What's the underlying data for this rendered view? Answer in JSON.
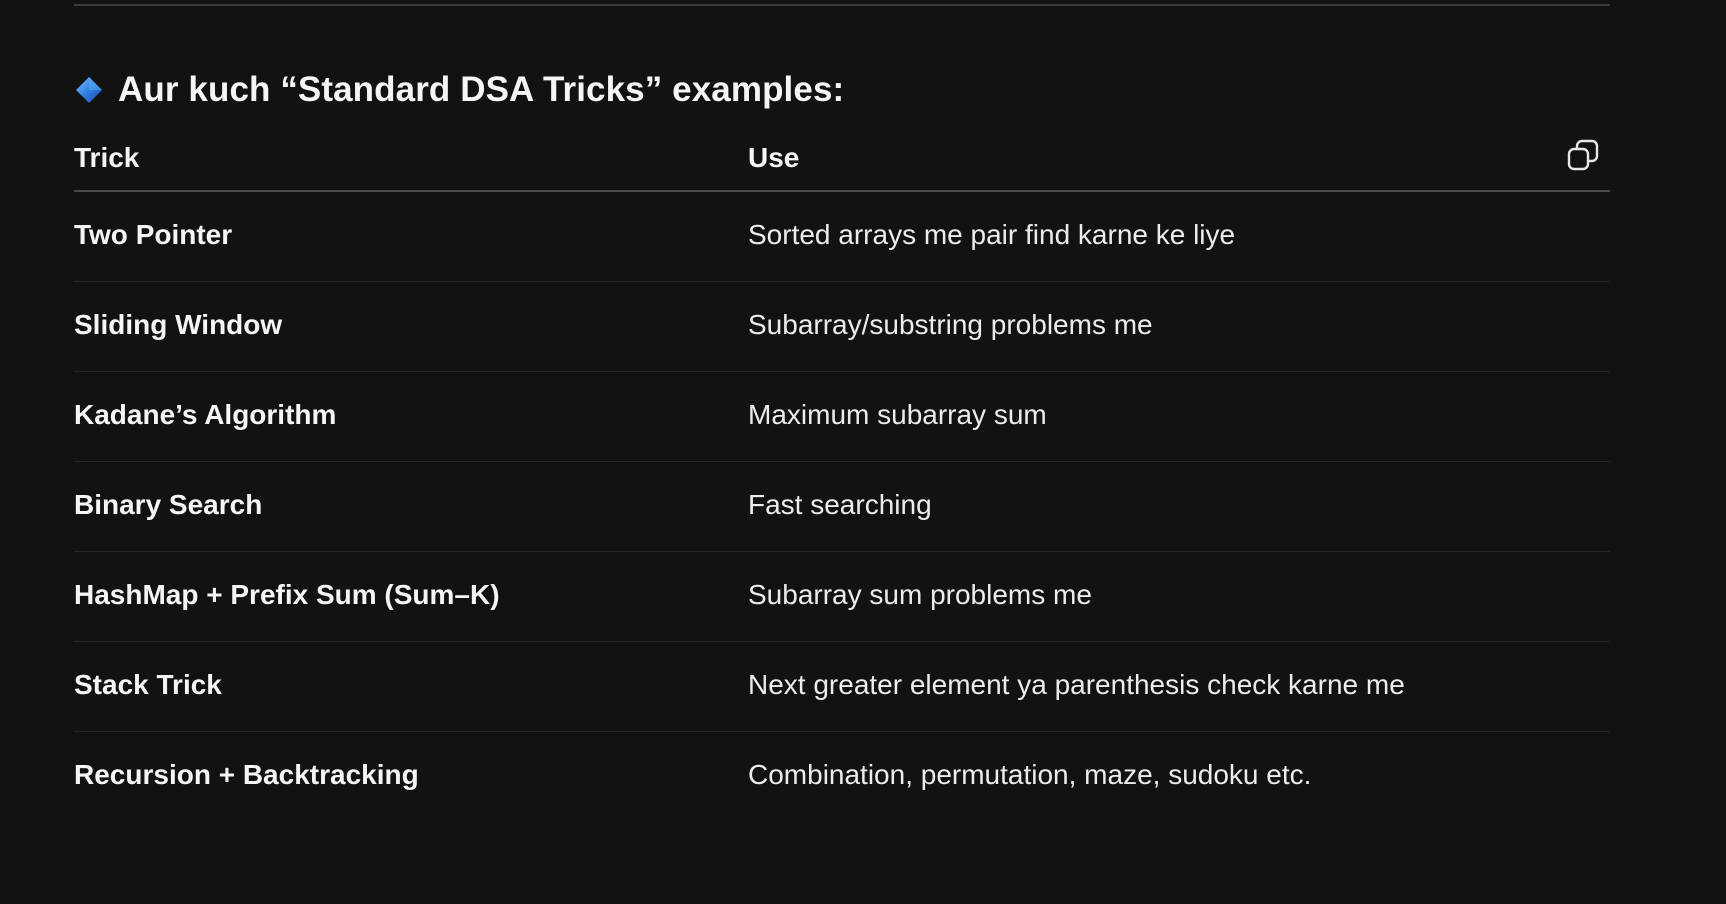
{
  "heading": {
    "icon": "small-blue-diamond-icon",
    "text": "Aur kuch “Standard DSA Tricks” examples:"
  },
  "table": {
    "columns": [
      "Trick",
      "Use"
    ],
    "copy_icon": "copy-icon",
    "rows": [
      {
        "trick": "Two Pointer",
        "use": "Sorted arrays me pair find karne ke liye"
      },
      {
        "trick": "Sliding Window",
        "use": "Subarray/substring problems me"
      },
      {
        "trick": "Kadane’s Algorithm",
        "use": "Maximum subarray sum"
      },
      {
        "trick": "Binary Search",
        "use": "Fast searching"
      },
      {
        "trick": "HashMap + Prefix Sum (Sum–K)",
        "use": "Subarray sum problems me"
      },
      {
        "trick": "Stack Trick",
        "use": "Next greater element ya parenthesis check karne me"
      },
      {
        "trick": "Recursion + Backtracking",
        "use": "Combination, permutation, maze, sudoku etc."
      }
    ]
  },
  "colors": {
    "background": "#121212",
    "text": "#f3f3f3",
    "divider": "#262626",
    "header_rule": "#4a4a4a",
    "diamond": "#2f7fe0"
  }
}
